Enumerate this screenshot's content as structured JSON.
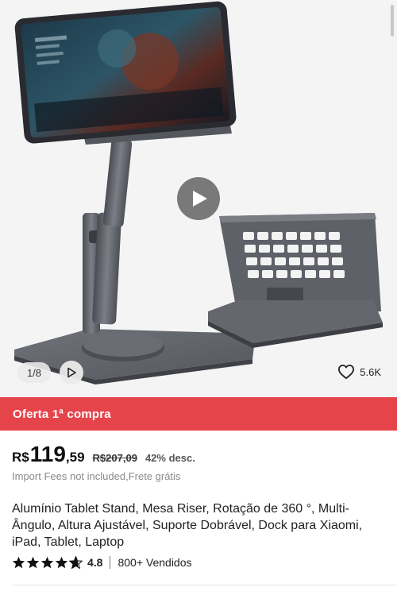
{
  "gallery": {
    "counter": "1/8",
    "likes": "5.6K",
    "icons": {
      "play": "play-icon",
      "like": "heart-outline-icon"
    }
  },
  "offer": {
    "label": "Oferta 1ª compra",
    "color": "#e6444b"
  },
  "price": {
    "currency": "R$",
    "integer": "119",
    "cents": ",59",
    "original": "R$207,09",
    "discount": "42% desc."
  },
  "fees_note": "Import Fees not included,Frete grátis",
  "product": {
    "title": "Alumínio Tablet Stand, Mesa Riser, Rotação de 360 °, Multi-Ângulo, Altura Ajustável, Suporte Dobrável, Dock para Xiaomi, iPad, Tablet, Laptop"
  },
  "rating": {
    "stars": 4.8,
    "value": "4.8",
    "sold": "800+ Vendidos",
    "icon": "star-icon"
  }
}
